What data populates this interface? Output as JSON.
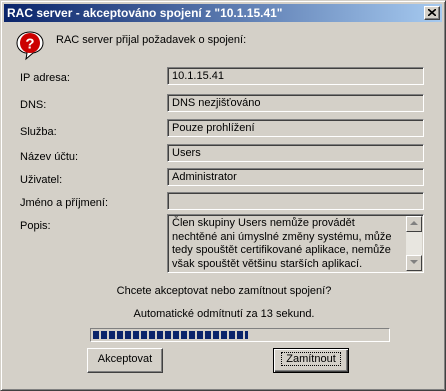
{
  "window": {
    "title": "RAC server - akceptováno spojení z \"10.1.15.41\""
  },
  "header": {
    "icon": "question-icon",
    "text": "RAC server přijal požadavek o spojení:"
  },
  "fields": {
    "ip": {
      "label": "IP adresa:",
      "value": "10.1.15.41"
    },
    "dns": {
      "label": "DNS:",
      "value": "DNS nezjišťováno"
    },
    "service": {
      "label": "Služba:",
      "value": "Pouze prohlížení"
    },
    "account": {
      "label": "Název účtu:",
      "value": "Users"
    },
    "user": {
      "label": "Uživatel:",
      "value": "Administrator"
    },
    "fullname": {
      "label": "Jméno a příjmení:",
      "value": ""
    },
    "description": {
      "label": "Popis:",
      "value": "Člen skupiny Users nemůže provádět nechtěné ani úmyslné změny systému, může tedy spouštět certifikované aplikace, nemůže však spouštět většinu starších aplikací."
    }
  },
  "prompt": "Chcete akceptovat nebo zamítnout spojení?",
  "countdown": "Automatické odmítnutí za 13 sekund.",
  "progress": {
    "percent": 53
  },
  "buttons": {
    "accept": "Akceptovat",
    "reject": "Zamítnout"
  },
  "colors": {
    "titlebar_start": "#0a246a",
    "titlebar_end": "#a6caf0",
    "face": "#d4d0c8",
    "icon_red": "#cc0000"
  }
}
